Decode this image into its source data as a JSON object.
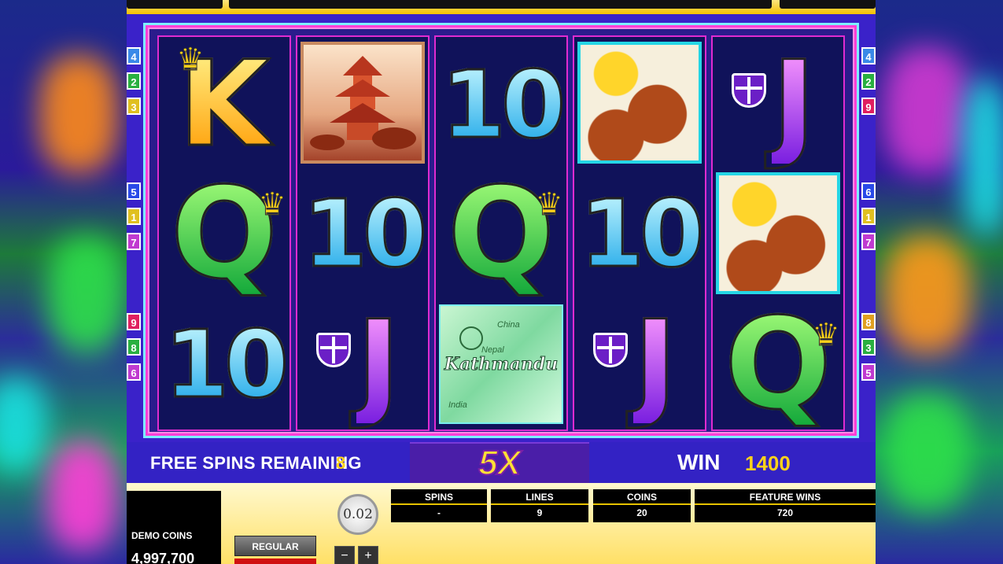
{
  "reels": [
    [
      {
        "type": "K"
      },
      {
        "type": "Q"
      },
      {
        "type": "10"
      }
    ],
    [
      {
        "type": "pagoda"
      },
      {
        "type": "10"
      },
      {
        "type": "J"
      }
    ],
    [
      {
        "type": "10"
      },
      {
        "type": "Q"
      },
      {
        "type": "map"
      }
    ],
    [
      {
        "type": "spice"
      },
      {
        "type": "10"
      },
      {
        "type": "J"
      }
    ],
    [
      {
        "type": "J"
      },
      {
        "type": "spice"
      },
      {
        "type": "Q"
      }
    ]
  ],
  "symbols": {
    "K": "K",
    "Q": "Q",
    "ten": "10",
    "J": "J",
    "map_label": "Kathmandu",
    "map_small": [
      "China",
      "Nepal",
      "India"
    ]
  },
  "side_numbers": {
    "left": [
      "4",
      "2",
      "3",
      "5",
      "1",
      "7",
      "9",
      "8",
      "6"
    ],
    "right": [
      "4",
      "2",
      "9",
      "6",
      "1",
      "7",
      "8",
      "3",
      "5"
    ]
  },
  "status": {
    "free_spins_label": "FREE SPINS REMAINING",
    "free_spins_value": "8",
    "multiplier": "5X",
    "win_label": "WIN",
    "win_value": "1400"
  },
  "panel": {
    "demo_label": "DEMO COINS",
    "demo_value": "4,997,700",
    "regular_button": "REGULAR",
    "coin_value": "0.02",
    "minus": "−",
    "plus": "+",
    "stats": [
      {
        "label": "SPINS",
        "value": "-"
      },
      {
        "label": "LINES",
        "value": "9"
      },
      {
        "label": "COINS",
        "value": "20"
      },
      {
        "label": "FEATURE WINS",
        "value": "720"
      }
    ]
  },
  "colors": {
    "frame_pink": "#ff3fd7",
    "frame_cyan": "#7ef0ff",
    "accent_yellow": "#ffd21a",
    "status_bg": "#3322c4"
  }
}
